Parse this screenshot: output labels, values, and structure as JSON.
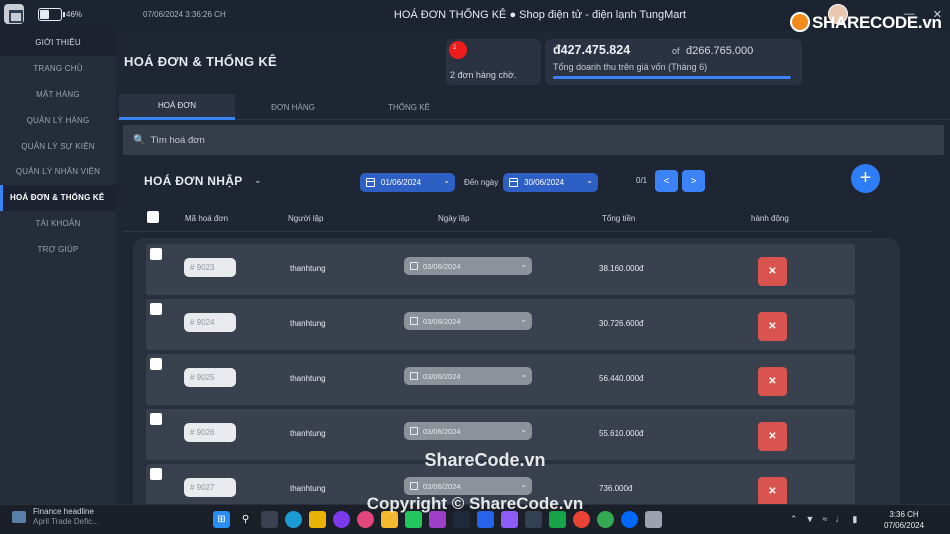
{
  "titlebar": {
    "battery_pct": "46%",
    "battery_level": 0.46,
    "datetime": "07/06/2024 3:36:26 CH",
    "title": "HOÁ ĐƠN  THỐNG KÊ ● Shop điện tử - điện lạnh TungMart",
    "minimize": "—",
    "close": "✕"
  },
  "sidebar": {
    "items": [
      {
        "label": "GIỚI THIỆU"
      },
      {
        "label": "TRANG CHỦ"
      },
      {
        "label": "MẶT HÀNG"
      },
      {
        "label": "QUẢN LÝ HÀNG"
      },
      {
        "label": "QUẢN LÝ SỰ KIỆN"
      },
      {
        "label": "QUẢN LÝ NHÂN VIÊN"
      },
      {
        "label": "HOÁ ĐƠN & THỐNG KÊ"
      },
      {
        "label": "TÀI KHOẢN"
      },
      {
        "label": "TRỢ GIÚP"
      }
    ]
  },
  "header": {
    "page_title": "HOÁ ĐƠN & THỐNG KÊ",
    "pending_count": "2",
    "pending_text": "2 đơn hàng chờ.",
    "revenue_amount": "đ427.475.824",
    "revenue_of": "of",
    "revenue_capital": "đ266.765.000",
    "revenue_label": "Tổng doanh thu trên giá vốn (Tháng 6)",
    "revenue_progress": 0.99
  },
  "tabs": [
    {
      "label": "HOÁ ĐƠN"
    },
    {
      "label": "ĐƠN HÀNG"
    },
    {
      "label": "THỐNG KÊ"
    }
  ],
  "search": {
    "placeholder": "Tìm hoá đơn"
  },
  "list": {
    "title": "HOÁ ĐƠN NHẬP",
    "from_date": "01/06/2024",
    "to_label": "Đến ngày",
    "to_date": "30/06/2024",
    "page_count": "0/1",
    "prev": "<",
    "next": ">",
    "add": "+"
  },
  "columns": {
    "code": "Mã hoá đơn",
    "creator": "Người lập",
    "date": "Ngày lập",
    "total": "Tổng tiền",
    "action": "hành động"
  },
  "rows": [
    {
      "code": "# 9023",
      "creator": "thanhtung",
      "date": "03/06/2024",
      "total": "38.160.000đ",
      "delete": "✕"
    },
    {
      "code": "# 9024",
      "creator": "thanhtung",
      "date": "03/06/2024",
      "total": "30.726.600đ",
      "delete": "✕"
    },
    {
      "code": "# 9025",
      "creator": "thanhtung",
      "date": "03/06/2024",
      "total": "56.440.000đ",
      "delete": "✕"
    },
    {
      "code": "# 9026",
      "creator": "thanhtung",
      "date": "03/06/2024",
      "total": "55.610.000đ",
      "delete": "✕"
    },
    {
      "code": "# 9027",
      "creator": "thanhtung",
      "date": "03/06/2024",
      "total": "736.000đ",
      "delete": "✕"
    }
  ],
  "taskbar": {
    "news_title": "Finance headline",
    "news_sub": "April Trade Defic...",
    "clock_time": "3:36 CH",
    "clock_date": "07/06/2024",
    "icons": [
      "windows-icon",
      "search-icon",
      "task-view-icon",
      "edge-icon",
      "store-icon",
      "media-icon",
      "app-icon",
      "explorer-icon",
      "code-icon",
      "rider-icon",
      "jetbrains-icon",
      "vscode-icon",
      "visual-studio-icon",
      "terminal-icon",
      "tools-icon",
      "chrome-icon",
      "chrome-alt-icon",
      "zalo-icon",
      "app-window-icon"
    ]
  },
  "watermarks": {
    "logo": "SHARECODE.vn",
    "center": "ShareCode.vn",
    "bottom": "Copyright © ShareCode.vn"
  },
  "colors": {
    "accent": "#3b82f6",
    "danger": "#d9534f",
    "background": "#1f2633",
    "sidebar": "#262d3a"
  }
}
